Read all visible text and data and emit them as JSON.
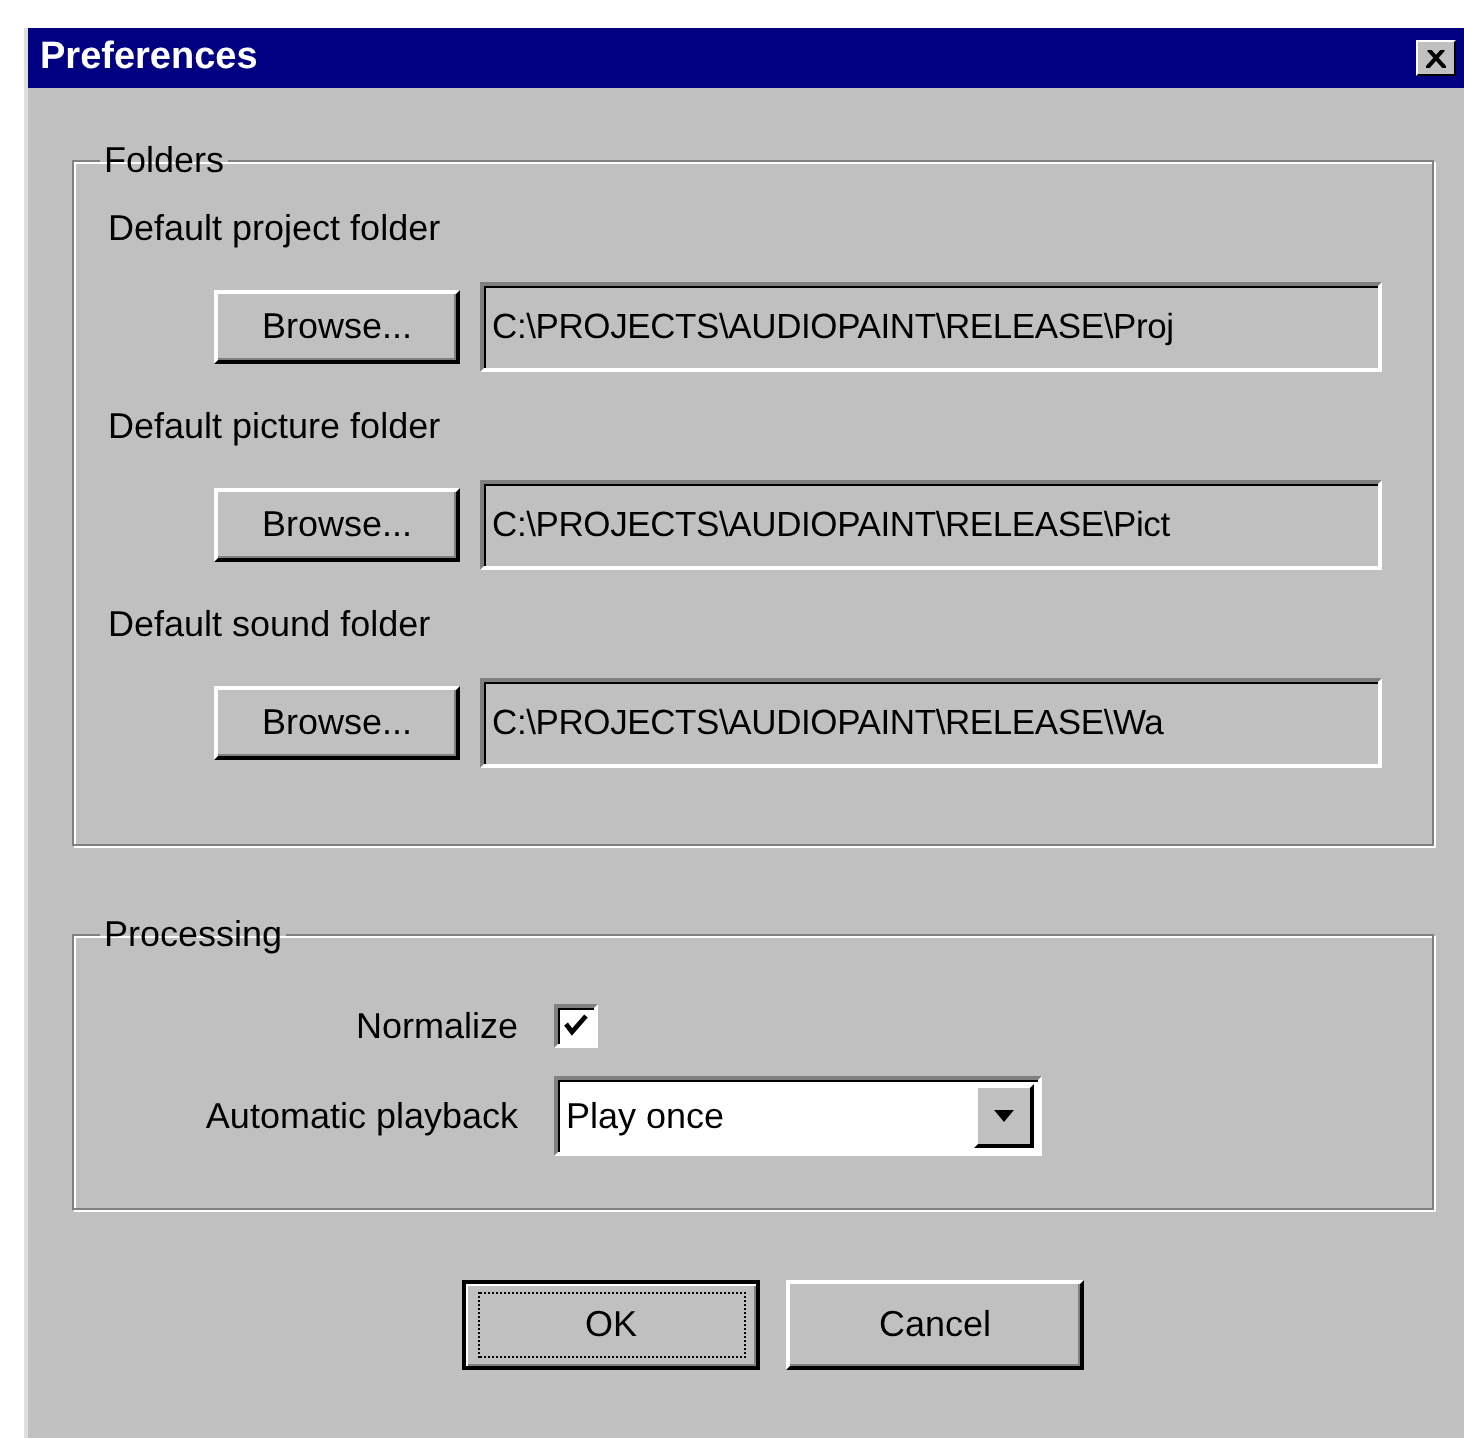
{
  "window": {
    "title": "Preferences"
  },
  "folders": {
    "title": "Folders",
    "items": [
      {
        "label": "Default project folder",
        "button": "Browse...",
        "path": "C:\\PROJECTS\\AUDIOPAINT\\RELEASE\\Proj"
      },
      {
        "label": "Default picture folder",
        "button": "Browse...",
        "path": "C:\\PROJECTS\\AUDIOPAINT\\RELEASE\\Pict"
      },
      {
        "label": "Default sound folder",
        "button": "Browse...",
        "path": "C:\\PROJECTS\\AUDIOPAINT\\RELEASE\\Wa"
      }
    ]
  },
  "processing": {
    "title": "Processing",
    "normalize": {
      "label": "Normalize",
      "checked": true
    },
    "playback": {
      "label": "Automatic playback",
      "value": "Play once"
    }
  },
  "buttons": [
    {
      "label": "OK",
      "default": true
    },
    {
      "label": "Cancel",
      "default": false
    }
  ]
}
